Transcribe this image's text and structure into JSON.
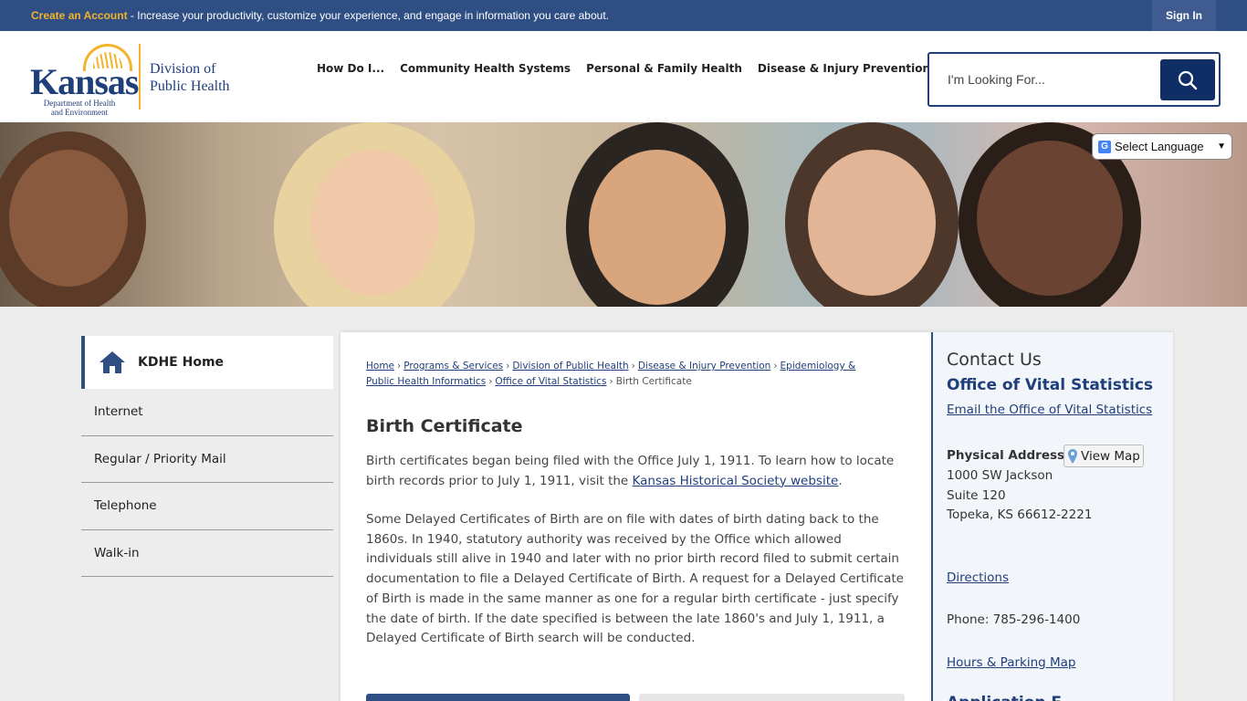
{
  "topbar": {
    "create_account": "Create an Account",
    "promo_text": " - Increase your productivity, customize your experience, and engage in information you care about.",
    "sign_in": "Sign In"
  },
  "logo": {
    "kansas": "Kansas",
    "dept_line1": "Department of Health",
    "dept_line2": "and Environment",
    "division_line1": "Division of",
    "division_line2": "Public Health"
  },
  "nav": {
    "items": [
      "How Do I...",
      "Community Health Systems",
      "Personal & Family Health",
      "Disease & Injury Prevention"
    ]
  },
  "search": {
    "placeholder": "I'm Looking For..."
  },
  "language": {
    "label": "Select Language"
  },
  "sidenav": {
    "home": "KDHE Home",
    "items": [
      "Internet",
      "Regular / Priority Mail",
      "Telephone",
      "Walk-in"
    ]
  },
  "breadcrumb": {
    "links": [
      "Home",
      "Programs & Services",
      "Division of Public Health",
      "Disease & Injury Prevention",
      "Epidemiology &",
      "Public Health Informatics",
      "Office of Vital Statistics"
    ],
    "current": "Birth Certificate"
  },
  "page": {
    "title": "Birth Certificate",
    "p1_before": "Birth certificates began being filed with the Office July 1, 1911. To learn how to locate birth records prior to July 1, 1911, visit the ",
    "p1_link": "Kansas Historical Society website",
    "p1_after": ".",
    "p2": "Some Delayed Certificates of Birth are on file with dates of birth dating back to the 1860s. In 1940, statutory authority was received by the Office which allowed individuals still alive in 1940 and later with no prior birth record filed to submit certain documentation to file a Delayed Certificate of Birth. A request for a Delayed Certificate of Birth is made in the same manner as one for a regular birth certificate - just specify the date of birth. If the date specified is between the late 1860's and July 1, 1911, a Delayed Certificate of Birth search will be conducted."
  },
  "contact": {
    "heading": "Contact Us",
    "org": "Office of Vital Statistics",
    "email_link": "Email the Office of Vital Statistics",
    "address_label": "Physical Address",
    "view_map": "View Map",
    "address_line1": "1000 SW Jackson",
    "address_line2": "Suite 120",
    "address_line3": "Topeka, KS 66612-2221",
    "directions": "Directions",
    "phone": "Phone: 785-296-1400",
    "hours": "Hours & Parking Map",
    "next_heading": "Application F"
  },
  "colors": {
    "brand_blue": "#2f4e84",
    "accent_gold": "#f3b42b",
    "dark_blue": "#0f2e66"
  }
}
